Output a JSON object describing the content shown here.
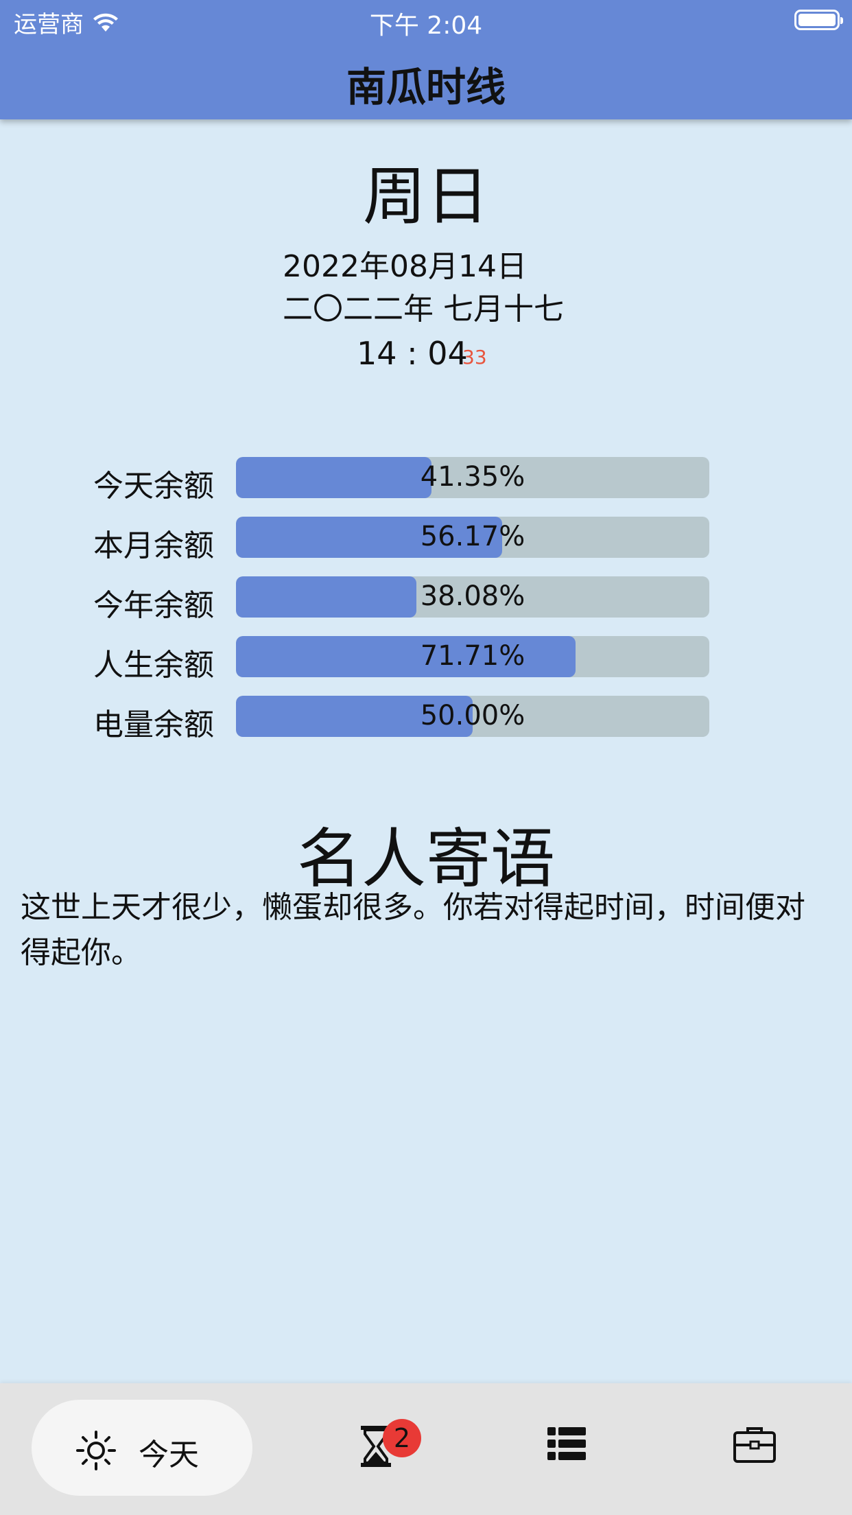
{
  "status_bar": {
    "carrier": "运营商",
    "time": "下午 2:04"
  },
  "header": {
    "title": "南瓜时线"
  },
  "today": {
    "weekday": "周日",
    "gregorian_date": "2022年08月14日",
    "lunar_date": "二〇二二年 七月十七",
    "clock": "14 : 04",
    "seconds": "33"
  },
  "progress": [
    {
      "label": "今天余额",
      "value_text": "41.35%",
      "value": 0.4135
    },
    {
      "label": "本月余额",
      "value_text": "56.17%",
      "value": 0.5617
    },
    {
      "label": "今年余额",
      "value_text": "38.08%",
      "value": 0.3808
    },
    {
      "label": "人生余额",
      "value_text": "71.71%",
      "value": 0.7171
    },
    {
      "label": "电量余额",
      "value_text": "50.00%",
      "value": 0.5
    }
  ],
  "quote": {
    "title": "名人寄语",
    "text": "这世上天才很少，懒蛋却很多。你若对得起时间，时间便对得起你。"
  },
  "tabbar": {
    "tabs": [
      {
        "label": "今天",
        "icon": "sun-icon",
        "active": true
      },
      {
        "icon": "hourglass-icon",
        "badge": "2"
      },
      {
        "icon": "list-icon"
      },
      {
        "icon": "briefcase-icon"
      }
    ]
  },
  "colors": {
    "header": "#6688d6",
    "background": "#d9eaf6",
    "track": "#b8c8cd",
    "seconds": "#e8553e",
    "badge": "#e83a36"
  }
}
